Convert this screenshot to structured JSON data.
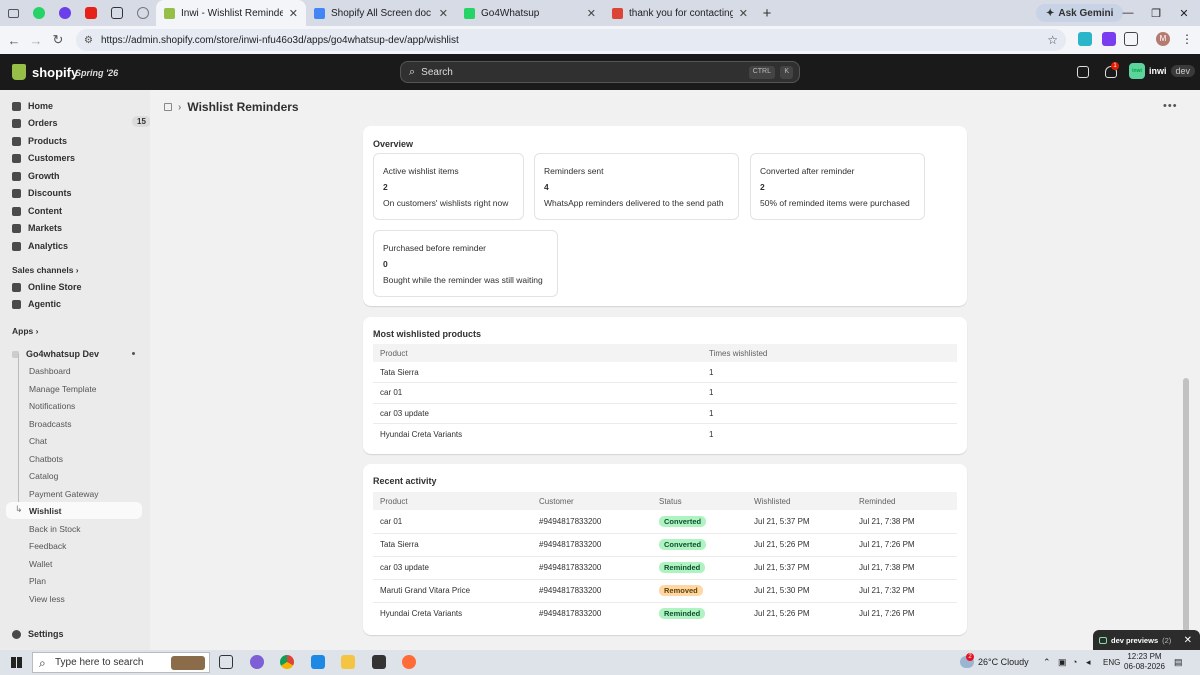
{
  "browser": {
    "tabs": [
      {
        "title": "Inwi - Wishlist Reminders - Shopify",
        "active": true,
        "favicon_color": "#95bf47"
      },
      {
        "title": "Shopify All Screen doc - Google Docs",
        "active": false,
        "favicon_color": "#4285f4"
      },
      {
        "title": "Go4Whatsup",
        "active": false,
        "favicon_color": "#25d366"
      },
      {
        "title": "thank you for contacting our app",
        "active": false,
        "favicon_color": "#db4437"
      }
    ],
    "new_tab": "+",
    "ask_gemini": "Ask Gemini",
    "url": "https://admin.shopify.com/store/inwi-nfu46o3d/apps/go4whatsup-dev/app/wishlist",
    "profile_initial": "M"
  },
  "shopify_bar": {
    "logo_text": "shopify",
    "edition": "Spring '26",
    "search_placeholder": "Search",
    "shortcut_ctrl": "CTRL",
    "shortcut_key": "K",
    "notification_count": "1",
    "store_name": "inwi",
    "store_avatar": "inwi",
    "store_env": "dev"
  },
  "sidebar": {
    "main_items": [
      {
        "label": "Home",
        "icon": "home-icon"
      },
      {
        "label": "Orders",
        "icon": "orders-icon",
        "badge": "15"
      },
      {
        "label": "Products",
        "icon": "products-icon"
      },
      {
        "label": "Customers",
        "icon": "customers-icon"
      },
      {
        "label": "Growth",
        "icon": "growth-icon"
      },
      {
        "label": "Discounts",
        "icon": "discounts-icon"
      },
      {
        "label": "Content",
        "icon": "content-icon"
      },
      {
        "label": "Markets",
        "icon": "markets-icon"
      },
      {
        "label": "Analytics",
        "icon": "analytics-icon"
      }
    ],
    "sales_channels_label": "Sales channels",
    "sales_channels": [
      {
        "label": "Online Store",
        "icon": "online-store-icon"
      },
      {
        "label": "Agentic",
        "icon": "agentic-icon"
      }
    ],
    "apps_label": "Apps",
    "app_name": "Go4whatsup Dev",
    "app_pages": [
      "Dashboard",
      "Manage Template",
      "Notifications",
      "Broadcasts",
      "Chat",
      "Chatbots",
      "Catalog",
      "Payment Gateway",
      "Wishlist",
      "Back in Stock",
      "Feedback",
      "Wallet",
      "Plan",
      "View less"
    ],
    "settings_label": "Settings"
  },
  "page": {
    "title": "Wishlist Reminders",
    "overview": {
      "title": "Overview",
      "stats": [
        {
          "label": "Active wishlist items",
          "value": "2",
          "desc": "On customers' wishlists right now"
        },
        {
          "label": "Reminders sent",
          "value": "4",
          "desc": "WhatsApp reminders delivered to the send path"
        },
        {
          "label": "Converted after reminder",
          "value": "2",
          "desc": "50% of reminded items were purchased"
        },
        {
          "label": "Purchased before reminder",
          "value": "0",
          "desc": "Bought while the reminder was still waiting"
        }
      ]
    },
    "most_wishlisted": {
      "title": "Most wishlisted products",
      "columns": [
        "Product",
        "Times wishlisted"
      ],
      "rows": [
        [
          "Tata Sierra",
          "1"
        ],
        [
          "car 01",
          "1"
        ],
        [
          "car 03 update",
          "1"
        ],
        [
          "Hyundai Creta Variants",
          "1"
        ]
      ]
    },
    "recent_activity": {
      "title": "Recent activity",
      "columns": [
        "Product",
        "Customer",
        "Status",
        "Wishlisted",
        "Reminded"
      ],
      "rows": [
        {
          "product": "car 01",
          "customer": "#9494817833200",
          "status": "Converted",
          "wishlisted": "Jul 21, 5:37 PM",
          "reminded": "Jul 21, 7:38 PM"
        },
        {
          "product": "Tata Sierra",
          "customer": "#9494817833200",
          "status": "Converted",
          "wishlisted": "Jul 21, 5:26 PM",
          "reminded": "Jul 21, 7:26 PM"
        },
        {
          "product": "car 03 update",
          "customer": "#9494817833200",
          "status": "Reminded",
          "wishlisted": "Jul 21, 5:37 PM",
          "reminded": "Jul 21, 7:38 PM"
        },
        {
          "product": "Maruti Grand Vitara Price",
          "customer": "#9494817833200",
          "status": "Removed",
          "wishlisted": "Jul 21, 5:30 PM",
          "reminded": "Jul 21, 7:32 PM"
        },
        {
          "product": "Hyundai Creta Variants",
          "customer": "#9494817833200",
          "status": "Reminded",
          "wishlisted": "Jul 21, 5:26 PM",
          "reminded": "Jul 21, 7:26 PM"
        }
      ],
      "status_colors": {
        "Converted": {
          "bg": "#aff3c0",
          "fg": "#0c5132"
        },
        "Reminded": {
          "bg": "#aff3c0",
          "fg": "#0c5132"
        },
        "Removed": {
          "bg": "#ffd6a4",
          "fg": "#5e4200"
        }
      }
    }
  },
  "toast": {
    "label": "dev previews",
    "count": "(2)"
  },
  "taskbar": {
    "search_placeholder": "Type here to search",
    "weather_badge": "2",
    "weather": "26°C  Cloudy",
    "language": "ENG",
    "time": "12:23 PM",
    "date": "06-08-2026"
  }
}
